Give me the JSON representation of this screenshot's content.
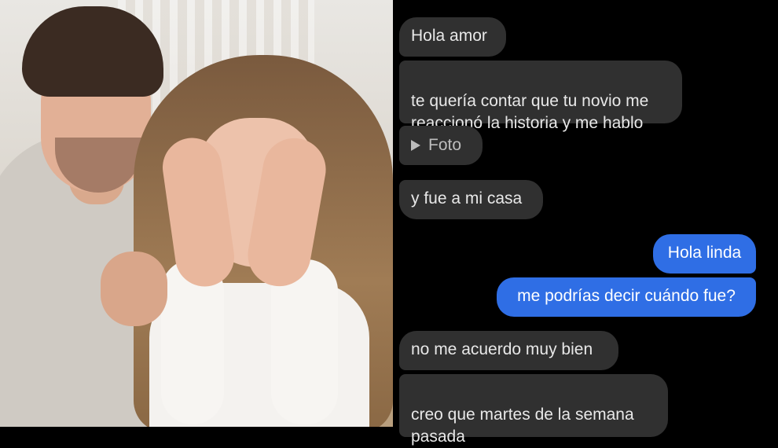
{
  "photo": {
    "description_icon": "couple-photo"
  },
  "chat": {
    "messages": [
      {
        "side": "incoming",
        "text": "Hola amor"
      },
      {
        "side": "incoming",
        "text": "te quería contar que tu novio me\nreaccionó la historia y me hablo"
      },
      {
        "side": "incoming",
        "type": "photo",
        "text": "Foto",
        "icon": "play-icon"
      },
      {
        "side": "incoming",
        "text": "y fue a mi casa"
      },
      {
        "side": "outgoing",
        "text": "Hola linda"
      },
      {
        "side": "outgoing",
        "text": "me podrías decir cuándo fue?"
      },
      {
        "side": "incoming",
        "text": "no me acuerdo muy bien"
      },
      {
        "side": "incoming",
        "text": "creo que martes de la semana\npasada"
      }
    ]
  },
  "colors": {
    "background": "#000000",
    "incoming_bubble": "#303030",
    "outgoing_bubble": "#2f6ee5",
    "incoming_text": "#e8e8e8",
    "outgoing_text": "#ffffff"
  }
}
